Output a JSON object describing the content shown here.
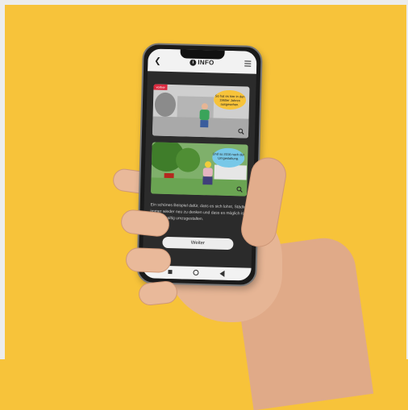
{
  "colors": {
    "background": "#f7c33a",
    "badge": "#d9273d",
    "screen": "#2b2b2b"
  },
  "app": {
    "title": "INFO",
    "back_icon": "chevron-left-icon",
    "menu_icon": "hamburger-menu-icon",
    "info_icon": "info-icon"
  },
  "cards": [
    {
      "badge": "vorher",
      "bubble": "So hat es hier in den 1960er Jahren ausgesehen."
    },
    {
      "bubble": "Und so 2016 nach der Umgestaltung."
    }
  ],
  "body_text": "Ein schönes Beispiel dafür, dass es sich lohnt, Städte immer wieder neu zu denken und dass es möglich ist, sie nachhaltig umzugestalten.",
  "button": {
    "label": "Weiter"
  },
  "navbar": {
    "recents_icon": "square-icon",
    "home_icon": "circle-icon",
    "back_icon": "triangle-back-icon"
  }
}
